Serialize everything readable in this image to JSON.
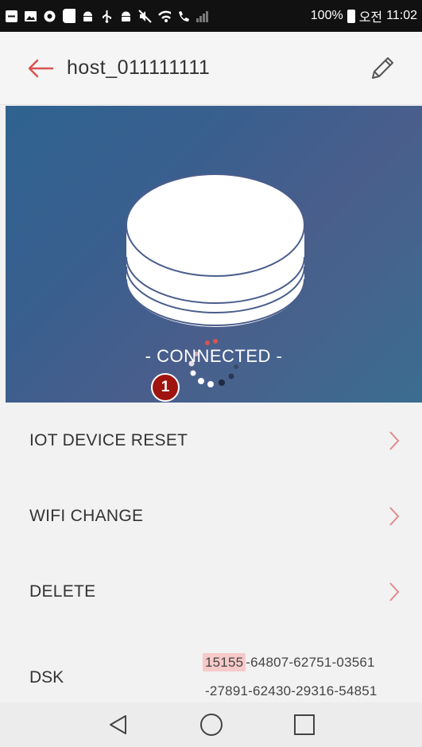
{
  "status_bar": {
    "battery_percent": "100%",
    "ampm": "오전",
    "time": "11:02",
    "icons": [
      "minus-box-icon",
      "image-icon",
      "app-icon",
      "square-icon",
      "android-icon",
      "usb-icon",
      "android-icon",
      "mute-icon",
      "wifi-icon",
      "phone-signal-icon",
      "signal-bars-icon",
      "battery-icon"
    ]
  },
  "app_bar": {
    "title": "host_011111111",
    "back_icon": "arrow-left-icon",
    "edit_icon": "pencil-icon"
  },
  "hero": {
    "status_text": "- CONNECTED -",
    "marker": "1",
    "device_icon": "hub-device-icon",
    "spinner_icon": "loading-spinner-icon"
  },
  "menu": {
    "items": [
      {
        "label": "IOT DEVICE RESET"
      },
      {
        "label": "WIFI CHANGE"
      },
      {
        "label": "DELETE"
      }
    ]
  },
  "dsk": {
    "label": "DSK",
    "highlight": "15155",
    "line1_rest": "-64807-62751-03561",
    "line2": "-27891-62430-29316-54851"
  },
  "colors": {
    "accent": "#d9534f",
    "hero_gradient_start": "#2f6390",
    "hero_gradient_end": "#4a5e8c",
    "marker": "#a0140f",
    "highlight": "#f8c9c9"
  }
}
